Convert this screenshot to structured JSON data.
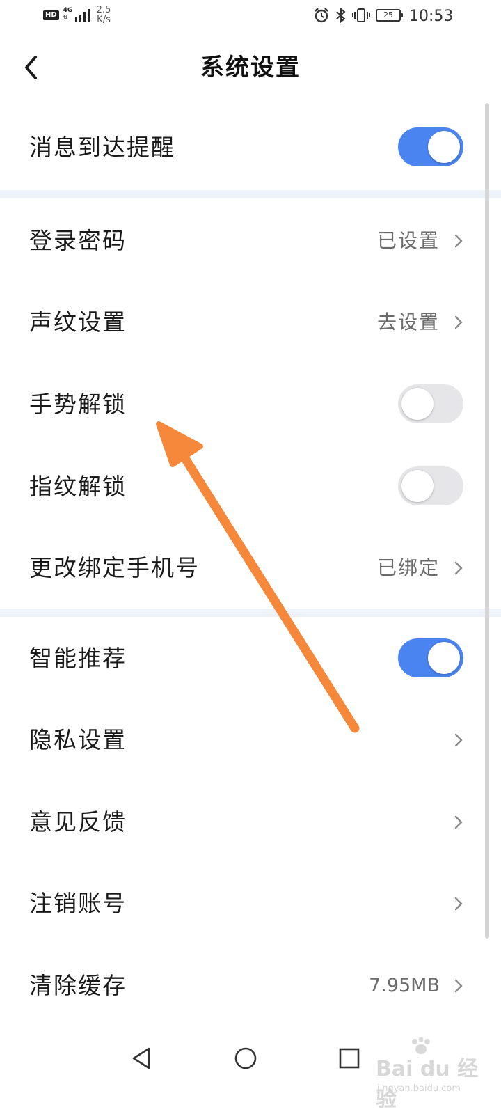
{
  "status_bar": {
    "hd": "HD",
    "network": "4G",
    "speed_value": "2.5",
    "speed_unit": "K/s",
    "battery": "25",
    "time": "10:53"
  },
  "header": {
    "title": "系统设置"
  },
  "settings": {
    "message_alert": {
      "label": "消息到达提醒",
      "enabled": true
    },
    "login_password": {
      "label": "登录密码",
      "value": "已设置"
    },
    "voiceprint": {
      "label": "声纹设置",
      "value": "去设置"
    },
    "gesture_unlock": {
      "label": "手势解锁",
      "enabled": false
    },
    "fingerprint_unlock": {
      "label": "指纹解锁",
      "enabled": false
    },
    "change_phone": {
      "label": "更改绑定手机号",
      "value": "已绑定"
    },
    "smart_recommend": {
      "label": "智能推荐",
      "enabled": true
    },
    "privacy": {
      "label": "隐私设置"
    },
    "feedback": {
      "label": "意见反馈"
    },
    "cancel_account": {
      "label": "注销账号"
    },
    "clear_cache": {
      "label": "清除缓存",
      "value": "7.95MB"
    }
  },
  "colors": {
    "toggle_on": "#4a84f0",
    "toggle_off": "#e6e6e9",
    "section_divider": "#eef3fa",
    "annotation_arrow": "#f5883a"
  },
  "watermark": {
    "brand": "Bai du 经验",
    "url": "jingyan.baidu.com"
  }
}
